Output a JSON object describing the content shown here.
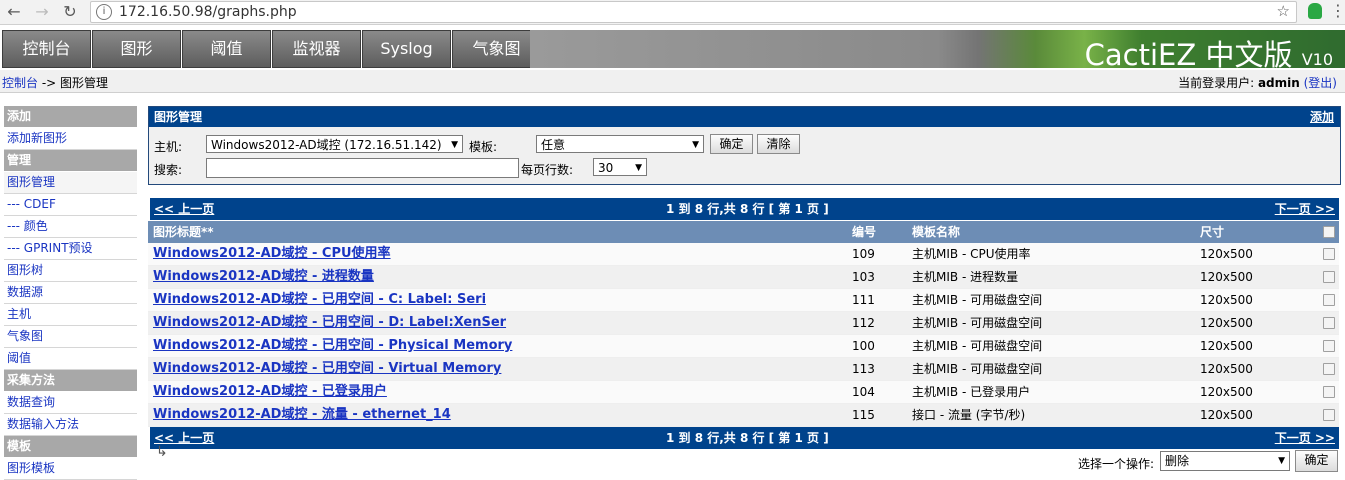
{
  "browser": {
    "url": "172.16.50.98/graphs.php",
    "back_icon": "arrow-left-icon",
    "forward_icon": "arrow-right-icon",
    "reload_icon": "reload-icon"
  },
  "nav": {
    "tabs": [
      "控制台",
      "图形",
      "阈值",
      "监视器",
      "Syslog",
      "气象图"
    ],
    "brand": "CactiEZ 中文版",
    "brand_version": "V10"
  },
  "breadcrumb": {
    "home": "控制台",
    "sep": " -> ",
    "current": "图形管理",
    "user_prefix": "当前登录用户: ",
    "user": "admin",
    "logout": "(登出)"
  },
  "sidebar": {
    "sections": [
      {
        "title": "添加",
        "items": [
          "添加新图形"
        ]
      },
      {
        "title": "管理",
        "items": [
          "图形管理",
          "--- CDEF",
          "--- 颜色",
          "--- GPRINT预设",
          "图形树",
          "数据源",
          "主机",
          "气象图",
          "阈值"
        ]
      },
      {
        "title": "采集方法",
        "items": [
          "数据查询",
          "数据输入方法"
        ]
      },
      {
        "title": "模板",
        "items": [
          "图形模板"
        ]
      }
    ],
    "active": "图形管理"
  },
  "filter": {
    "title": "图形管理",
    "add": "添加",
    "host_label": "主机:",
    "host_value": "Windows2012-AD域控 (172.16.51.142)",
    "template_label": "模板:",
    "template_value": "任意",
    "ok": "确定",
    "clear": "清除",
    "search_label": "搜索:",
    "search_value": "",
    "rows_label": "每页行数:",
    "rows_value": "30"
  },
  "pager": {
    "prev": "<< 上一页",
    "summary": "1 到 8 行,共 8 行 [ 第 1 页 ]",
    "next": "下一页 >>"
  },
  "table": {
    "headers": [
      "图形标题**",
      "编号",
      "模板名称",
      "尺寸"
    ],
    "rows": [
      {
        "title": "Windows2012-AD域控 - CPU使用率",
        "id": "109",
        "template": "主机MIB - CPU使用率",
        "size": "120x500"
      },
      {
        "title": "Windows2012-AD域控 - 进程数量",
        "id": "103",
        "template": "主机MIB - 进程数量",
        "size": "120x500"
      },
      {
        "title": "Windows2012-AD域控 - 已用空间 - C: Label: Seri",
        "id": "111",
        "template": "主机MIB - 可用磁盘空间",
        "size": "120x500"
      },
      {
        "title": "Windows2012-AD域控 - 已用空间 - D: Label:XenSer",
        "id": "112",
        "template": "主机MIB - 可用磁盘空间",
        "size": "120x500"
      },
      {
        "title": "Windows2012-AD域控 - 已用空间 - Physical Memory",
        "id": "100",
        "template": "主机MIB - 可用磁盘空间",
        "size": "120x500"
      },
      {
        "title": "Windows2012-AD域控 - 已用空间 - Virtual Memory",
        "id": "113",
        "template": "主机MIB - 可用磁盘空间",
        "size": "120x500"
      },
      {
        "title": "Windows2012-AD域控 - 已登录用户",
        "id": "104",
        "template": "主机MIB - 已登录用户",
        "size": "120x500"
      },
      {
        "title": "Windows2012-AD域控 - 流量 - ethernet_14",
        "id": "115",
        "template": "接口 - 流量 (字节/秒)",
        "size": "120x500"
      }
    ]
  },
  "actions": {
    "label": "选择一个操作:",
    "value": "删除",
    "ok": "确定"
  }
}
